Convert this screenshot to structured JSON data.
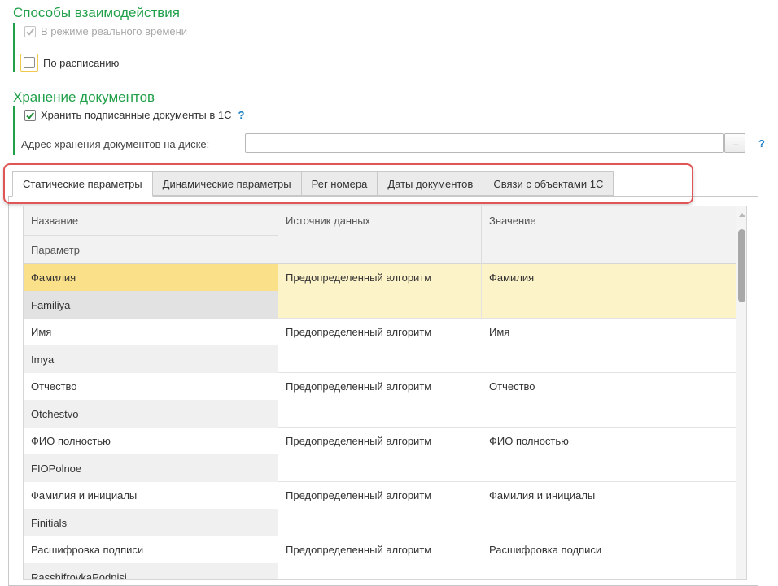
{
  "interaction": {
    "title": "Способы взаимодействия",
    "realtime_label": "В режиме реального времени",
    "realtime_checked": true,
    "schedule_label": "По расписанию",
    "schedule_checked": false
  },
  "storage": {
    "title": "Хранение документов",
    "store_signed_label": "Хранить подписанные документы в 1С",
    "store_signed_checked": true,
    "help_mark": "?",
    "address_label": "Адрес хранения документов на диске:",
    "address_value": "",
    "browse_label": "...",
    "address_help": "?"
  },
  "tabs": [
    {
      "label": "Статические параметры",
      "active": true
    },
    {
      "label": "Динамические параметры",
      "active": false
    },
    {
      "label": "Рег номера",
      "active": false
    },
    {
      "label": "Даты документов",
      "active": false
    },
    {
      "label": "Связи с объектами 1С",
      "active": false
    }
  ],
  "grid": {
    "headers": {
      "name": "Название",
      "param": "Параметр",
      "source": "Источник данных",
      "value": "Значение"
    },
    "rows": [
      {
        "name": "Фамилия",
        "param": "Familiya",
        "source": "Предопределенный алгоритм",
        "value": "Фамилия",
        "selected": true
      },
      {
        "name": "Имя",
        "param": "Imya",
        "source": "Предопределенный алгоритм",
        "value": "Имя",
        "selected": false
      },
      {
        "name": "Отчество",
        "param": "Otchestvo",
        "source": "Предопределенный алгоритм",
        "value": "Отчество",
        "selected": false
      },
      {
        "name": "ФИО полностью",
        "param": "FIOPolnoe",
        "source": "Предопределенный алгоритм",
        "value": "ФИО полностью",
        "selected": false
      },
      {
        "name": "Фамилия и инициалы",
        "param": "Finitials",
        "source": "Предопределенный алгоритм",
        "value": "Фамилия и инициалы",
        "selected": false
      },
      {
        "name": "Расшифровка подписи",
        "param": "RasshifrovkaPodpisi",
        "source": "Предопределенный алгоритм",
        "value": "Расшифровка подписи",
        "selected": false
      }
    ]
  },
  "colors": {
    "section_green": "#21a04a",
    "selected_row": "#fdf3c8",
    "selected_cell": "#fbe08a",
    "highlight_red": "#e05555",
    "help_blue": "#1a7fc4"
  }
}
